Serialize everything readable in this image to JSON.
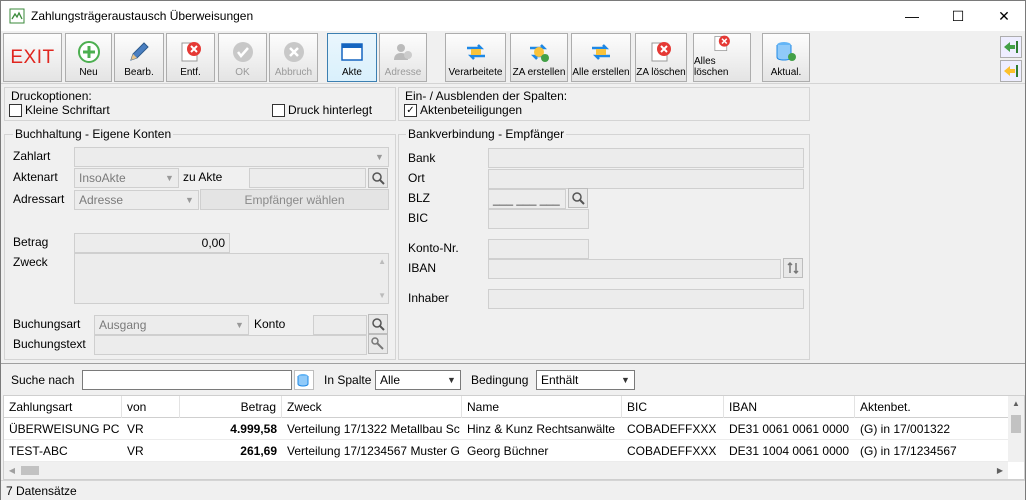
{
  "window": {
    "title": "Zahlungsträgeraustausch Überweisungen",
    "minimize": "—",
    "maximize": "☐",
    "close": "✕"
  },
  "toolbar": {
    "exit": "EXIT",
    "neu": "Neu",
    "bearb": "Bearb.",
    "entf": "Entf.",
    "ok": "OK",
    "abbruch": "Abbruch",
    "akte": "Akte",
    "adresse": "Adresse",
    "verarbeitete": "Verarbeitete",
    "za_erstellen": "ZA erstellen",
    "alle_erstellen": "Alle erstellen",
    "za_loeschen": "ZA löschen",
    "alle_loeschen": "Alles löschen",
    "aktual": "Aktual."
  },
  "druck": {
    "title": "Druckoptionen:",
    "kleine": "Kleine Schriftart",
    "hinterlegt": "Druck hinterlegt"
  },
  "spalten": {
    "title": "Ein- / Ausblenden der Spalten:",
    "aktenbet": "Aktenbeteiligungen",
    "aktenbet_checked": "✓"
  },
  "buchhaltung": {
    "title": "Buchhaltung - Eigene Konten",
    "zahlart": "Zahlart",
    "aktenart": "Aktenart",
    "aktenart_value": "InsoAkte",
    "zu_akte": "zu Akte",
    "adressart": "Adressart",
    "adressart_value": "Adresse",
    "empfaenger_btn": "Empfänger wählen",
    "betrag": "Betrag",
    "betrag_value": "0,00",
    "zweck": "Zweck",
    "buchungsart": "Buchungsart",
    "buchungsart_value": "Ausgang",
    "konto": "Konto",
    "buchungstext": "Buchungstext"
  },
  "bank": {
    "title": "Bankverbindung - Empfänger",
    "bank": "Bank",
    "ort": "Ort",
    "blz": "BLZ",
    "blz_mask": "___ ___ ___",
    "bic": "BIC",
    "konto_nr": "Konto-Nr.",
    "iban": "IBAN",
    "inhaber": "Inhaber"
  },
  "search": {
    "suche_nach": "Suche nach",
    "in_spalte": "In Spalte",
    "spalte_value": "Alle",
    "bedingung": "Bedingung",
    "bedingung_value": "Enthält"
  },
  "table": {
    "columns": [
      "Zahlungsart",
      "von",
      "Betrag",
      "Zweck",
      "Name",
      "BIC",
      "IBAN",
      "Aktenbet."
    ],
    "rows": [
      {
        "zahlungsart": "ÜBERWEISUNG PC",
        "von": "VR",
        "betrag": "4.999,58",
        "zweck": "Verteilung 17/1322 Metallbau Sc",
        "name": "Hinz & Kunz Rechtsanwälte",
        "bic": "COBADEFFXXX",
        "iban": "DE31 0061 0061 0000",
        "aktenbet": "(G) in 17/001322"
      },
      {
        "zahlungsart": "TEST-ABC",
        "von": "VR",
        "betrag": "261,69",
        "zweck": "Verteilung 17/1234567 Muster G",
        "name": "Georg Büchner",
        "bic": "COBADEFFXXX",
        "iban": "DE31 1004 0061 0000",
        "aktenbet": "(G) in 17/1234567"
      }
    ]
  },
  "status": {
    "text": "7 Datensätze"
  }
}
